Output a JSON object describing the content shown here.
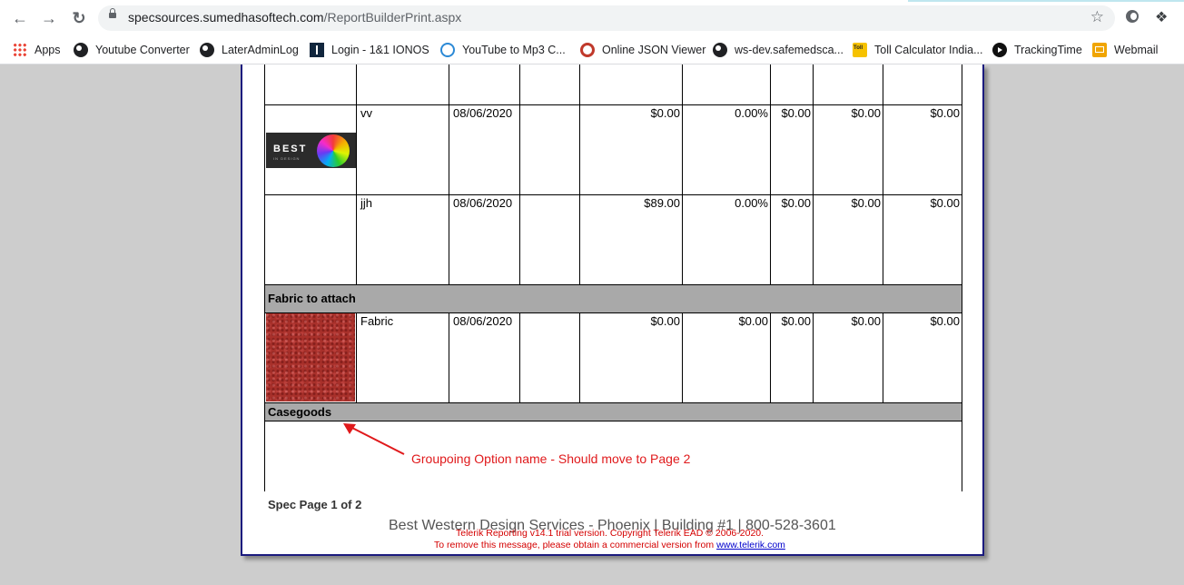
{
  "browser": {
    "url_host": "specsources.sumedhasoftech.com",
    "url_path": "/ReportBuilderPrint.aspx",
    "icons": [
      "back-arrow-icon",
      "forward-arrow-icon",
      "reload-icon",
      "lock-icon",
      "star-icon",
      "extension-icon",
      "puzzle-icon"
    ]
  },
  "bookmarks": [
    {
      "label": "Apps",
      "icon": "apps-grid-icon"
    },
    {
      "label": "Youtube Converter",
      "icon": "globe-icon"
    },
    {
      "label": "LaterAdminLog",
      "icon": "globe-icon"
    },
    {
      "label": "Login - 1&1 IONOS",
      "icon": "ionos-icon"
    },
    {
      "label": "YouTube to Mp3 C...",
      "icon": "cloud-download-icon"
    },
    {
      "label": "Online JSON Viewer",
      "icon": "ring-icon"
    },
    {
      "label": "ws-dev.safemedsca...",
      "icon": "globe-icon"
    },
    {
      "label": "Toll Calculator India...",
      "icon": "toll-icon"
    },
    {
      "label": "TrackingTime",
      "icon": "play-icon"
    },
    {
      "label": "Webmail",
      "icon": "mail-icon"
    }
  ],
  "report": {
    "rows": [
      {
        "name": "vv",
        "date": "08/06/2020",
        "c4": "",
        "amount": "$0.00",
        "percent": "0.00%",
        "c7": "$0.00",
        "c8": "$0.00",
        "c9": "$0.00",
        "image": "best-in-design-logo"
      },
      {
        "name": "jjh",
        "date": "08/06/2020",
        "c4": "",
        "amount": "$89.00",
        "percent": "0.00%",
        "c7": "$0.00",
        "c8": "$0.00",
        "c9": "$0.00",
        "image": ""
      }
    ],
    "group1": "Fabric to attach",
    "fabric_row": {
      "name": "Fabric",
      "date": "08/06/2020",
      "c4": "",
      "amount": "$0.00",
      "percent": "$0.00",
      "c7": "$0.00",
      "c8": "$0.00",
      "c9": "$0.00",
      "image": "fabric-swatch"
    },
    "group2": "Casegoods",
    "logo_text": "BEST",
    "logo_sub": "IN DESIGN",
    "page_label": "Spec Page 1 of 2",
    "footer_address": "Best Western Design Services - Phoenix | Building #1 | 800-528-3601",
    "trial_line1": "Telerik Reporting v14.1 trial version. Copyright Telerik EAD © 2006-2020.",
    "trial_line2": "To remove this message, please obtain a commercial version from ",
    "trial_link": "www.telerik.com"
  },
  "annotation": {
    "text": "Groupoing Option name - Should move to Page 2",
    "color": "#e0191b"
  }
}
